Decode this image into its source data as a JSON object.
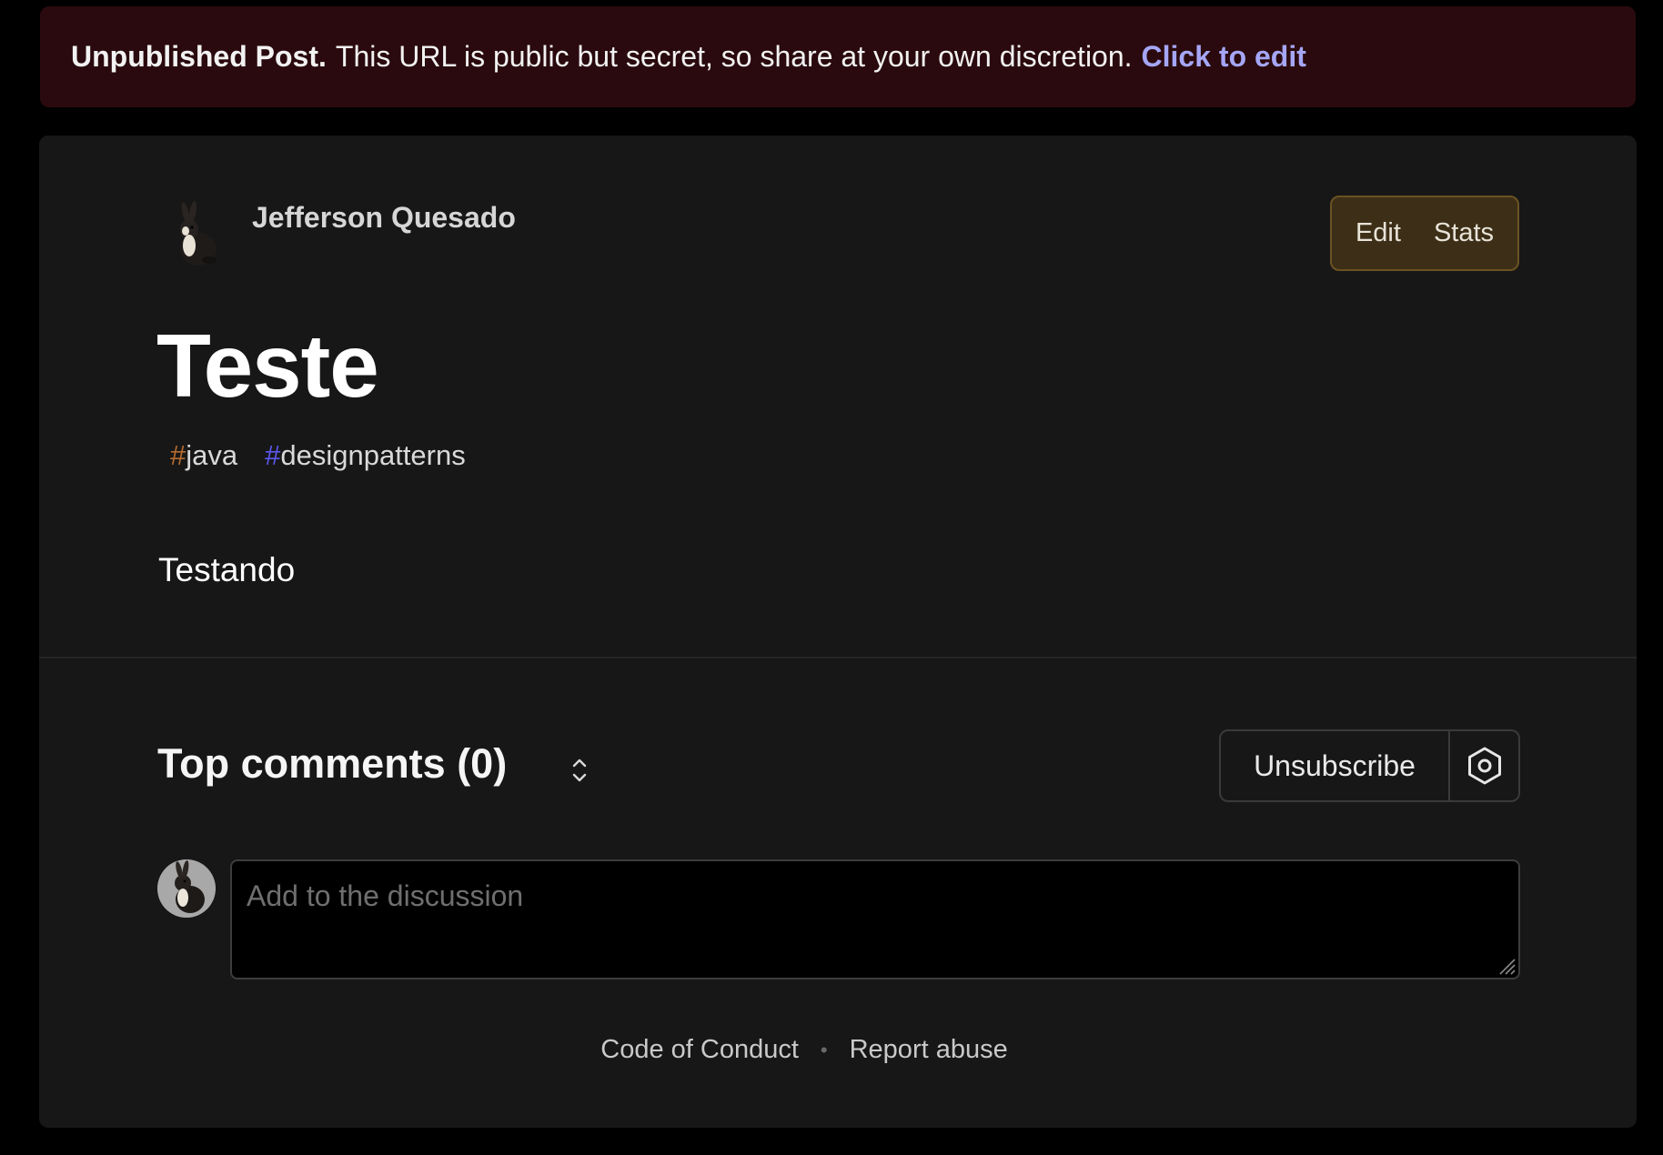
{
  "banner": {
    "strong": "Unpublished Post.",
    "message": "This URL is public but secret, so share at your own discretion.",
    "link": "Click to edit"
  },
  "post": {
    "author": "Jefferson Quesado",
    "actions": {
      "edit": "Edit",
      "stats": "Stats"
    },
    "title": "Teste",
    "tags": [
      {
        "hash": "#",
        "name": "java",
        "hash_color": "#b66b2e"
      },
      {
        "hash": "#",
        "name": "designpatterns",
        "hash_color": "#5b58f0"
      }
    ],
    "body": "Testando"
  },
  "comments": {
    "title": "Top comments (0)",
    "unsubscribe": "Unsubscribe",
    "placeholder": "Add to the discussion"
  },
  "footer": {
    "code_of_conduct": "Code of Conduct",
    "separator": "•",
    "report_abuse": "Report abuse"
  },
  "icons": {
    "avatar": "rabbit-avatar-icon",
    "sort": "sort-chevrons-icon",
    "settings": "hexagon-gear-icon",
    "resize": "textarea-resize-icon"
  }
}
